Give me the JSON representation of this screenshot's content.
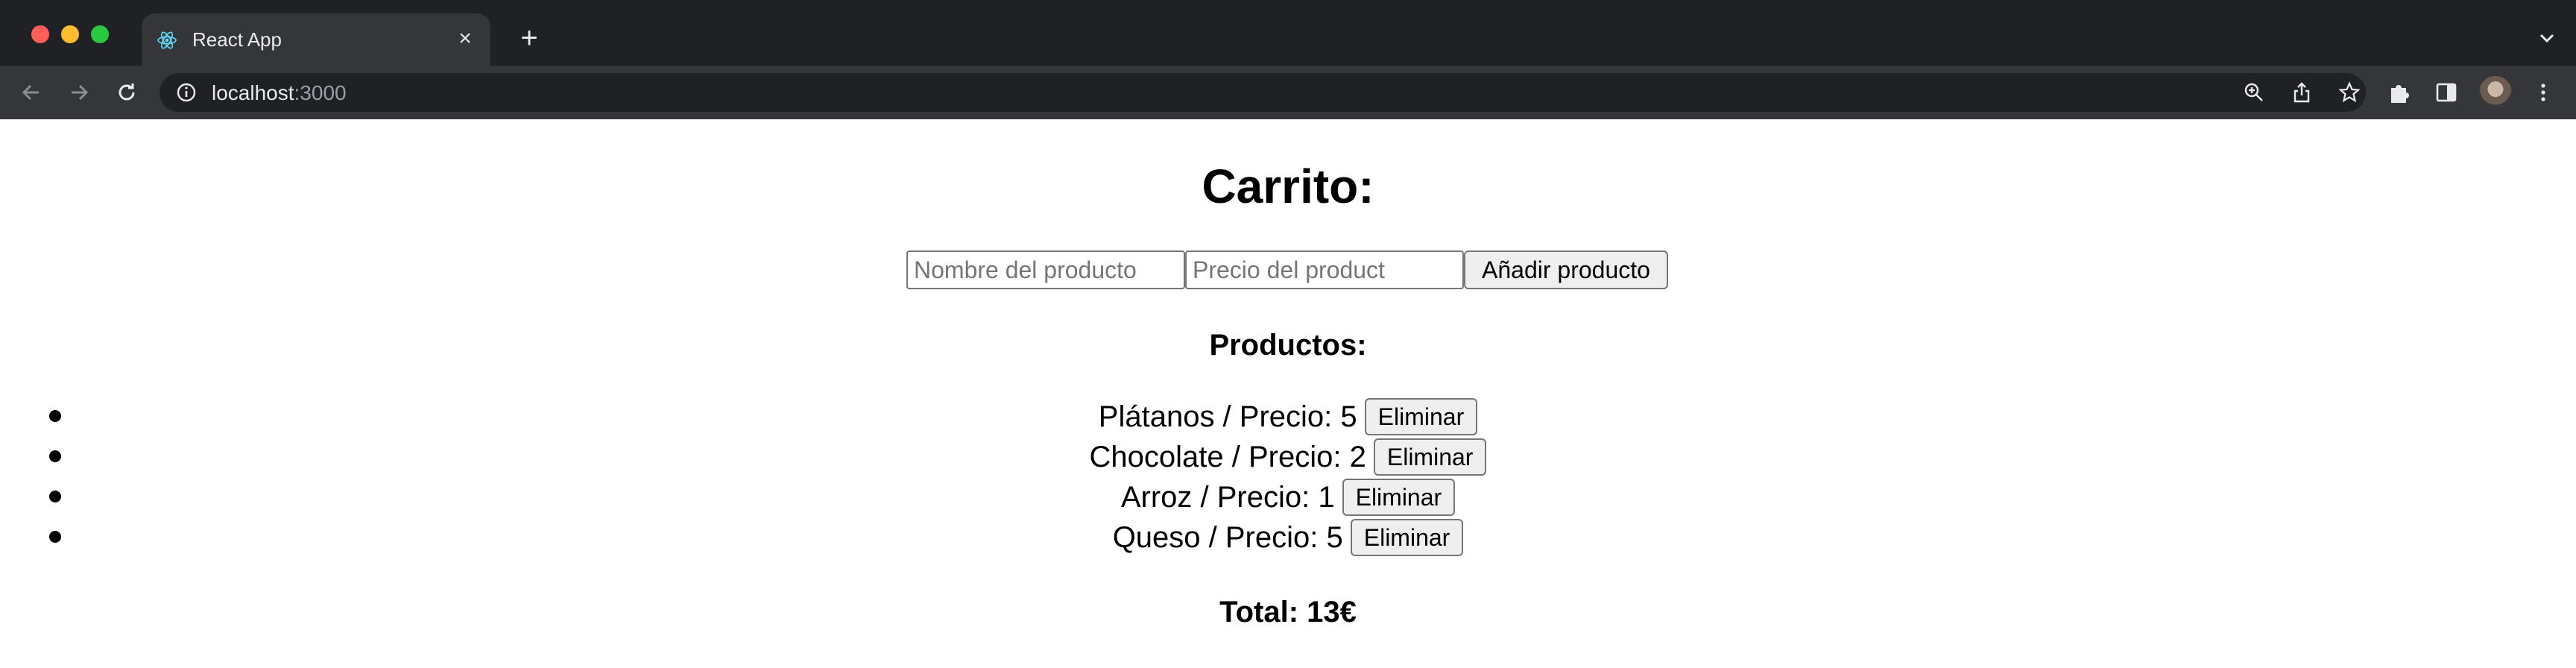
{
  "browser": {
    "tab_title": "React App",
    "url_host": "localhost",
    "url_port": ":3000"
  },
  "page": {
    "heading": "Carrito:",
    "form": {
      "name_placeholder": "Nombre del producto",
      "price_placeholder": "Precio del product",
      "name_value": "",
      "price_value": "",
      "add_label": "Añadir producto"
    },
    "products_heading": "Productos:",
    "products": [
      {
        "text": "Plátanos / Precio: 5",
        "delete_label": "Eliminar"
      },
      {
        "text": "Chocolate / Precio: 2",
        "delete_label": "Eliminar"
      },
      {
        "text": "Arroz / Precio: 1",
        "delete_label": "Eliminar"
      },
      {
        "text": "Queso / Precio: 5",
        "delete_label": "Eliminar"
      }
    ],
    "total": "Total: 13€"
  },
  "icons": {
    "tab_favicon": "react-logo-icon",
    "tab_close": "close-icon",
    "new_tab": "plus-icon",
    "tab_menu": "chevron-down-icon",
    "back": "arrow-left-icon",
    "forward": "arrow-right-icon",
    "reload": "reload-icon",
    "site_info": "info-icon",
    "zoom": "zoom-icon",
    "share": "share-icon",
    "bookmark": "star-icon",
    "extensions": "puzzle-icon",
    "side_panel": "side-panel-icon",
    "profile": "avatar",
    "menu": "kebab-menu-icon"
  },
  "colors": {
    "chrome_bg": "#202124",
    "toolbar_bg": "#35363a",
    "page_bg": "#ffffff",
    "button_bg": "#efefef"
  }
}
